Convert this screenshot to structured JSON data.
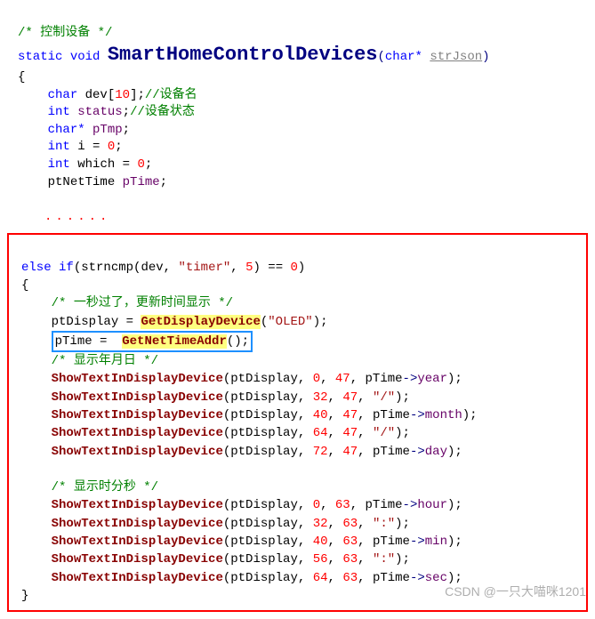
{
  "top": {
    "c1": "/* 控制设备 */",
    "l2_static": "static",
    "l2_void": "void",
    "l2_func": "SmartHomeControlDevices",
    "l2_ptype": "char*",
    "l2_pname": "strJson",
    "l3_char": "char",
    "l3_dev": "dev",
    "l3_10": "10",
    "l3_c": "//设备名",
    "l4_int": "int",
    "l4_status": "status",
    "l4_c": "//设备状态",
    "l5_char": "char*",
    "l5_pTmp": "pTmp",
    "l6_int": "int",
    "l6_i": "i",
    "l6_0": "0",
    "l7_int": "int",
    "l7_which": "which",
    "l7_0": "0",
    "l8_type": "ptNetTime",
    "l8_pTime": "pTime",
    "dots": "......"
  },
  "box": {
    "l1_else": "else if",
    "l1_strncmp": "strncmp",
    "l1_dev": "dev",
    "l1_timer": "\"timer\"",
    "l1_5": "5",
    "l1_0": "0",
    "c1": "/* 一秒过了，更新时间显示 */",
    "l3_ptDisplay": "ptDisplay",
    "l3_func": "GetDisplayDevice",
    "l3_oled": "\"OLED\"",
    "l4_pTime": "pTime",
    "l4_func": "GetNetTimeAddr",
    "c2": "/* 显示年月日 */",
    "show": "ShowTextInDisplayDevice",
    "ptDisplay": "ptDisplay",
    "pTime": "pTime",
    "arrow": "->",
    "year": "year",
    "month": "month",
    "day": "day",
    "hour": "hour",
    "min": "min",
    "sec": "sec",
    "slash": "\"/\"",
    "colon": "\":\"",
    "n0": "0",
    "n32": "32",
    "n40": "40",
    "n47": "47",
    "n56": "56",
    "n63": "63",
    "n64": "64",
    "n72": "72",
    "c3": "/* 显示时分秒 */"
  },
  "watermark": "CSDN @一只大喵咪1201"
}
